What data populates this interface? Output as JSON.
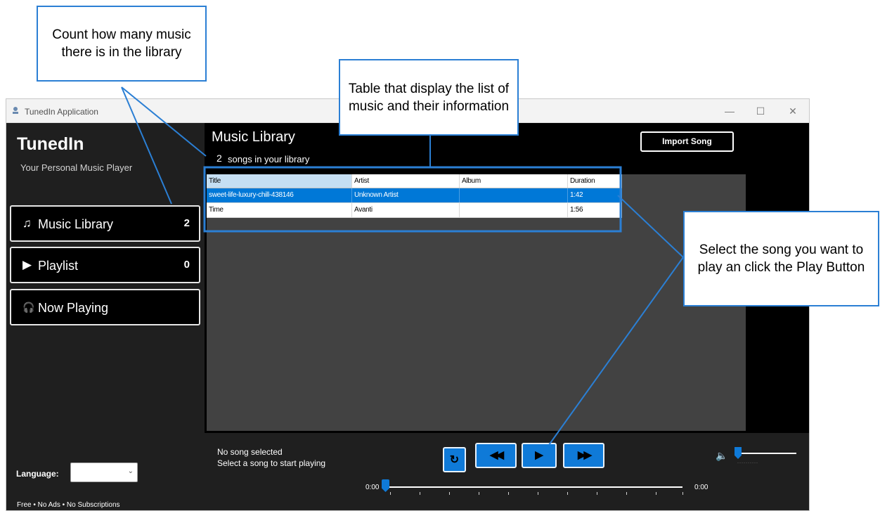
{
  "window": {
    "title": "TunedIn Application",
    "controls": {
      "minimize": "—",
      "maximize": "☐",
      "close": "✕"
    }
  },
  "sidebar": {
    "brand": "TunedIn",
    "tagline": "Your Personal Music Player",
    "nav": [
      {
        "icon": "♫",
        "label": "Music Library",
        "count": "2"
      },
      {
        "icon": "▶",
        "label": "Playlist",
        "count": "0"
      },
      {
        "icon": "🎧",
        "label": "Now Playing"
      }
    ],
    "language_label": "Language:",
    "language_value": "",
    "footer": "Free • No Ads • No Subscriptions"
  },
  "main": {
    "title": "Music Library",
    "song_count": "2",
    "song_count_label": "songs in your library",
    "import_button": "Import Song",
    "table": {
      "columns": [
        "Title",
        "Artist",
        "Album",
        "Duration"
      ],
      "rows": [
        {
          "title": "sweet-life-luxury-chill-438146",
          "artist": "Unknown Artist",
          "album": "",
          "duration": "1:42",
          "selected": true
        },
        {
          "title": "Time",
          "artist": "Avanti",
          "album": "",
          "duration": "1:56",
          "selected": false
        }
      ]
    }
  },
  "player": {
    "status": "No song selected",
    "hint": "Select a song to start playing",
    "current_time": "0:00",
    "total_time": "0:00",
    "seek_progress": 0,
    "volume": 0,
    "buttons": {
      "repeat": "↻",
      "previous": "◀◀",
      "play": "▶",
      "next": "▶▶"
    }
  },
  "annotations": {
    "count": "Count how many music there is in the library",
    "table": "Table that display the list of music and their information",
    "select": "Select the song you want to play an click the Play Button"
  },
  "colors": {
    "accent": "#0f7ad8",
    "callout_border": "#2b7fd4",
    "sidebar_bg": "#1f1f1f",
    "main_bg": "#000000",
    "content_bg": "#424242",
    "selected_row": "#0078d7"
  }
}
